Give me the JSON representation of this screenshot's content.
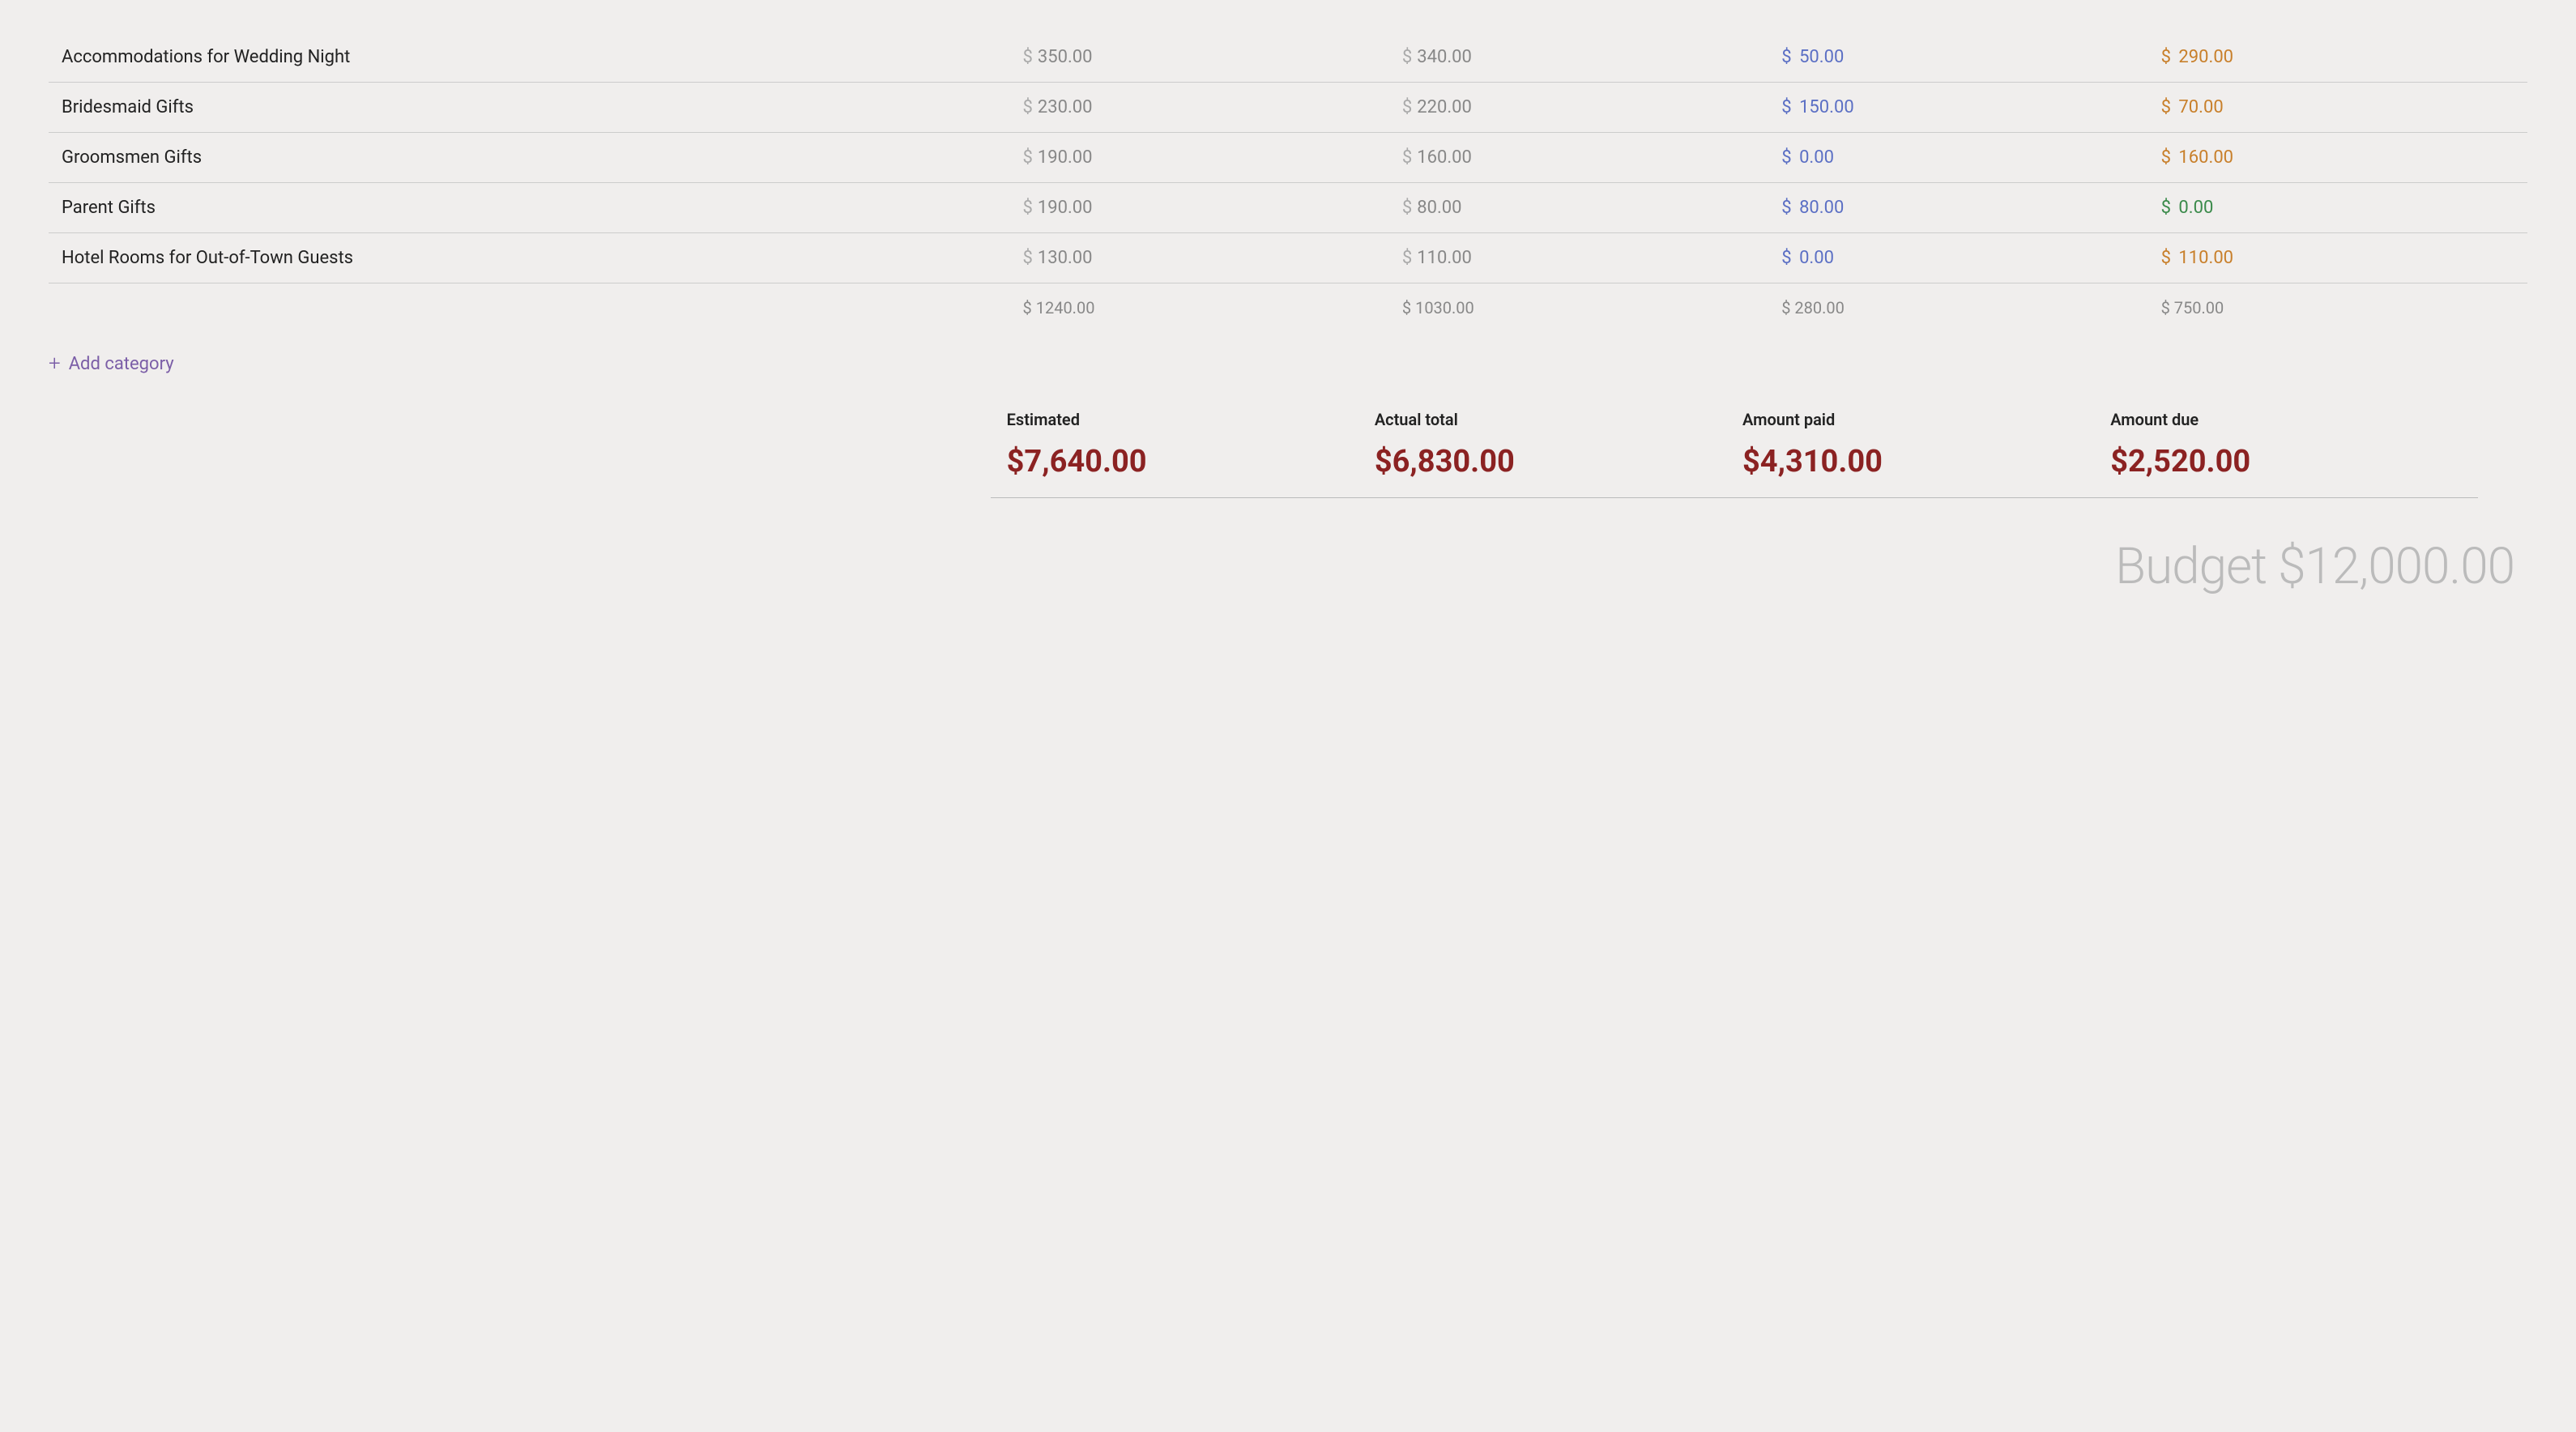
{
  "rows": [
    {
      "name": "Accommodations for Wedding Night",
      "estimated": "350.00",
      "actual": "340.00",
      "paid": "50.00",
      "due": "290.00",
      "due_color": "orange"
    },
    {
      "name": "Bridesmaid Gifts",
      "estimated": "230.00",
      "actual": "220.00",
      "paid": "150.00",
      "due": "70.00",
      "due_color": "orange"
    },
    {
      "name": "Groomsmen Gifts",
      "estimated": "190.00",
      "actual": "160.00",
      "paid": "0.00",
      "due": "160.00",
      "due_color": "orange"
    },
    {
      "name": "Parent Gifts",
      "estimated": "190.00",
      "actual": "80.00",
      "paid": "80.00",
      "due": "0.00",
      "due_color": "green"
    },
    {
      "name": "Hotel Rooms for Out-of-Town Guests",
      "estimated": "130.00",
      "actual": "110.00",
      "paid": "0.00",
      "due": "110.00",
      "due_color": "orange"
    }
  ],
  "subtotals": {
    "estimated": "$ 1240.00",
    "actual": "$ 1030.00",
    "paid": "$ 280.00",
    "due": "$ 750.00"
  },
  "add_category_label": "Add category",
  "summary": {
    "estimated_label": "Estimated",
    "actual_label": "Actual total",
    "paid_label": "Amount paid",
    "due_label": "Amount due",
    "estimated_value": "$7,640.00",
    "actual_value": "$6,830.00",
    "paid_value": "$4,310.00",
    "due_value": "$2,520.00"
  },
  "budget_label": "Budget $12,000.00",
  "colors": {
    "orange": "#c87f2a",
    "green": "#3a8a4a",
    "blue": "#5b6fc4",
    "purple": "#7b5ea7"
  }
}
